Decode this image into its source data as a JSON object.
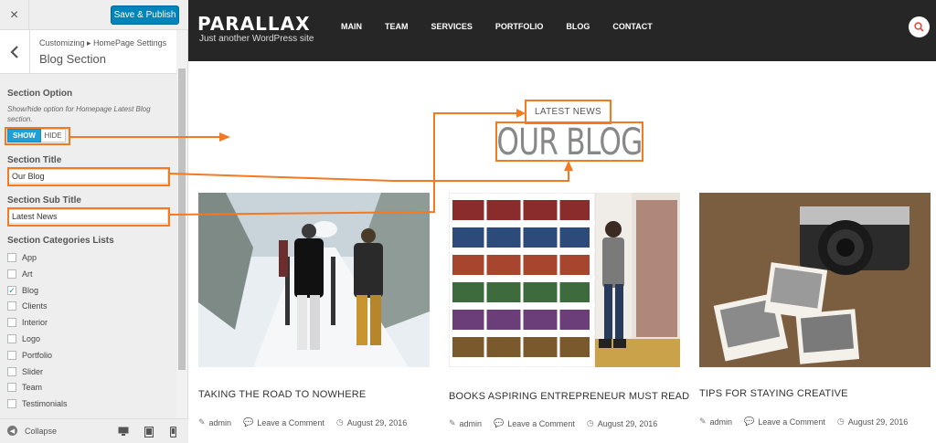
{
  "customizer": {
    "close_icon": "×",
    "publish_label": "Save & Publish",
    "back_icon": "‹",
    "breadcrumb": "Customizing ▸ HomePage Settings",
    "section_title": "Blog Section",
    "section_option_label": "Section Option",
    "section_option_desc": "Show/hide option for Homepage Latest Blog section.",
    "toggle_show": "SHOW",
    "toggle_hide": "HIDE",
    "toggle_selected": "SHOW",
    "section_title_label": "Section Title",
    "section_title_value": "Our Blog",
    "section_subtitle_label": "Section Sub Title",
    "section_subtitle_value": "Latest News",
    "categories_label": "Section Categories Lists",
    "categories": [
      {
        "name": "App",
        "checked": false
      },
      {
        "name": "Art",
        "checked": false
      },
      {
        "name": "Blog",
        "checked": true
      },
      {
        "name": "Clients",
        "checked": false
      },
      {
        "name": "Interior",
        "checked": false
      },
      {
        "name": "Logo",
        "checked": false
      },
      {
        "name": "Portfolio",
        "checked": false
      },
      {
        "name": "Slider",
        "checked": false
      },
      {
        "name": "Team",
        "checked": false
      },
      {
        "name": "Testimonials",
        "checked": false
      }
    ],
    "collapse_label": "Collapse"
  },
  "site": {
    "brand": "PARALLAX",
    "tagline": "Just another WordPress site",
    "nav": [
      "MAIN",
      "TEAM",
      "SERVICES",
      "PORTFOLIO",
      "BLOG",
      "CONTACT"
    ],
    "blog_kicker": "LATEST NEWS",
    "blog_title": "OUR BLOG",
    "posts": [
      {
        "title": "TAKING THE ROAD TO NOWHERE",
        "author": "admin",
        "comments": "Leave a Comment",
        "date": "August 29, 2016"
      },
      {
        "title": "BOOKS ASPIRING ENTREPRENEUR MUST READ",
        "author": "admin",
        "comments": "Leave a Comment",
        "date": "August 29, 2016"
      },
      {
        "title": "TIPS FOR STAYING CREATIVE",
        "author": "admin",
        "comments": "Leave a Comment",
        "date": "August 29, 2016"
      }
    ]
  },
  "colors": {
    "annotation": "#f47920",
    "publish": "#0085ba",
    "toggle_active": "#1e9fd8",
    "header_bg": "#262626"
  }
}
